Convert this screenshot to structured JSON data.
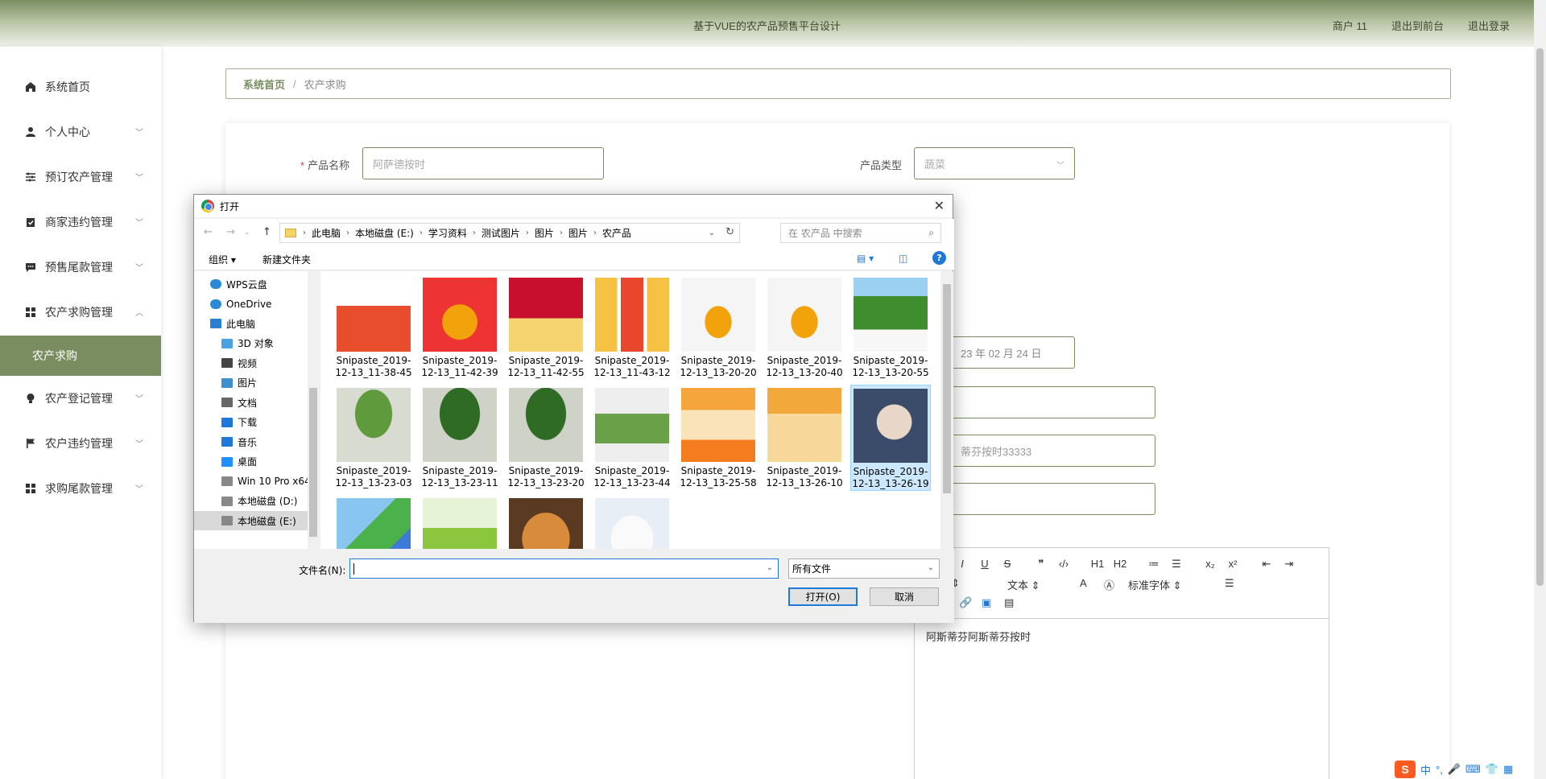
{
  "header": {
    "title": "基于VUE的农产品预售平台设计",
    "user": "商户 11",
    "back_front": "退出到前台",
    "logout": "退出登录"
  },
  "sidebar": {
    "items": [
      {
        "label": "系统首页",
        "icon": "home-icon"
      },
      {
        "label": "个人中心",
        "icon": "user-icon"
      },
      {
        "label": "预订农产管理",
        "icon": "sliders-icon"
      },
      {
        "label": "商家违约管理",
        "icon": "clipboard-icon"
      },
      {
        "label": "预售尾款管理",
        "icon": "chat-icon"
      },
      {
        "label": "农产求购管理",
        "icon": "grid-icon"
      },
      {
        "label": "农产求购",
        "icon": ""
      },
      {
        "label": "农产登记管理",
        "icon": "bulb-icon"
      },
      {
        "label": "农户违约管理",
        "icon": "flag-icon"
      },
      {
        "label": "求购尾款管理",
        "icon": "grid-icon"
      }
    ]
  },
  "breadcrumb": {
    "home": "系统首页",
    "sep": "/",
    "current": "农产求购"
  },
  "form": {
    "name_label": "产品名称",
    "name_placeholder": "阿萨德按时",
    "type_label": "产品类型",
    "type_value": "蔬菜",
    "date_value": "23 年 02 月 24 日",
    "field_value_2": "蒂芬按时33333",
    "editor_content": "阿斯蒂芬阿斯蒂芬按时",
    "editor_toolbar_row1": [
      "I",
      "U",
      "S",
      "❞",
      "‹/›",
      "H1",
      "H2",
      "≔",
      "☰",
      "x₂",
      "x²",
      "⇤",
      "⇥"
    ],
    "editor_font_size": "文本",
    "editor_font_family": "标准字体"
  },
  "dialog": {
    "title": "打开",
    "address": [
      "此电脑",
      "本地磁盘 (E:)",
      "学习资料",
      "测试图片",
      "图片",
      "图片",
      "农产品"
    ],
    "search_placeholder": "在 农产品 中搜索",
    "organize": "组织 ▾",
    "new_folder": "新建文件夹",
    "nav": [
      {
        "label": "WPS云盘",
        "icon": "cloud-icon",
        "indent": 20
      },
      {
        "label": "OneDrive",
        "icon": "cloud-icon",
        "indent": 20
      },
      {
        "label": "此电脑",
        "icon": "computer-icon",
        "indent": 20
      },
      {
        "label": "3D 对象",
        "icon": "cube-icon",
        "indent": 34
      },
      {
        "label": "视频",
        "icon": "video-icon",
        "indent": 34
      },
      {
        "label": "图片",
        "icon": "image-icon",
        "indent": 34
      },
      {
        "label": "文档",
        "icon": "document-icon",
        "indent": 34
      },
      {
        "label": "下载",
        "icon": "download-icon",
        "indent": 34
      },
      {
        "label": "音乐",
        "icon": "music-icon",
        "indent": 34
      },
      {
        "label": "桌面",
        "icon": "desktop-icon",
        "indent": 34
      },
      {
        "label": "Win 10 Pro x64",
        "icon": "drive-icon",
        "indent": 34
      },
      {
        "label": "本地磁盘 (D:)",
        "icon": "drive-icon",
        "indent": 34
      },
      {
        "label": "本地磁盘 (E:)",
        "icon": "drive-icon",
        "indent": 34
      }
    ],
    "files": [
      {
        "name": "Snipaste_2019-12-13_11-38-45",
        "art": "banner-red"
      },
      {
        "name": "Snipaste_2019-12-13_11-42-39",
        "art": "oil-bottle"
      },
      {
        "name": "Snipaste_2019-12-13_11-42-55",
        "art": "red-poster"
      },
      {
        "name": "Snipaste_2019-12-13_11-43-12",
        "art": "oil-set"
      },
      {
        "name": "Snipaste_2019-12-13_13-20-20",
        "art": "oil-bottle-white"
      },
      {
        "name": "Snipaste_2019-12-13_13-20-40",
        "art": "oil-bottle-white"
      },
      {
        "name": "Snipaste_2019-12-13_13-20-55",
        "art": "field"
      },
      {
        "name": "Snipaste_2019-12-13_13-23-03",
        "art": "tree"
      },
      {
        "name": "Snipaste_2019-12-13_13-23-11",
        "art": "tree-dark"
      },
      {
        "name": "Snipaste_2019-12-13_13-23-20",
        "art": "tree-dark"
      },
      {
        "name": "Snipaste_2019-12-13_13-23-44",
        "art": "tree-text"
      },
      {
        "name": "Snipaste_2019-12-13_13-25-58",
        "art": "orange-box"
      },
      {
        "name": "Snipaste_2019-12-13_13-26-10",
        "art": "orange-box2"
      },
      {
        "name": "Snipaste_2019-12-13_13-26-19",
        "art": "person"
      },
      {
        "name": "",
        "art": "parrots"
      },
      {
        "name": "",
        "art": "green-poster"
      },
      {
        "name": "",
        "art": "dog"
      },
      {
        "name": "",
        "art": "white-dog"
      }
    ],
    "filename_label": "文件名(N):",
    "filename_value": "",
    "filetype": "所有文件",
    "open_button": "打开(O)",
    "cancel_button": "取消"
  },
  "ime": {
    "label": "中"
  }
}
